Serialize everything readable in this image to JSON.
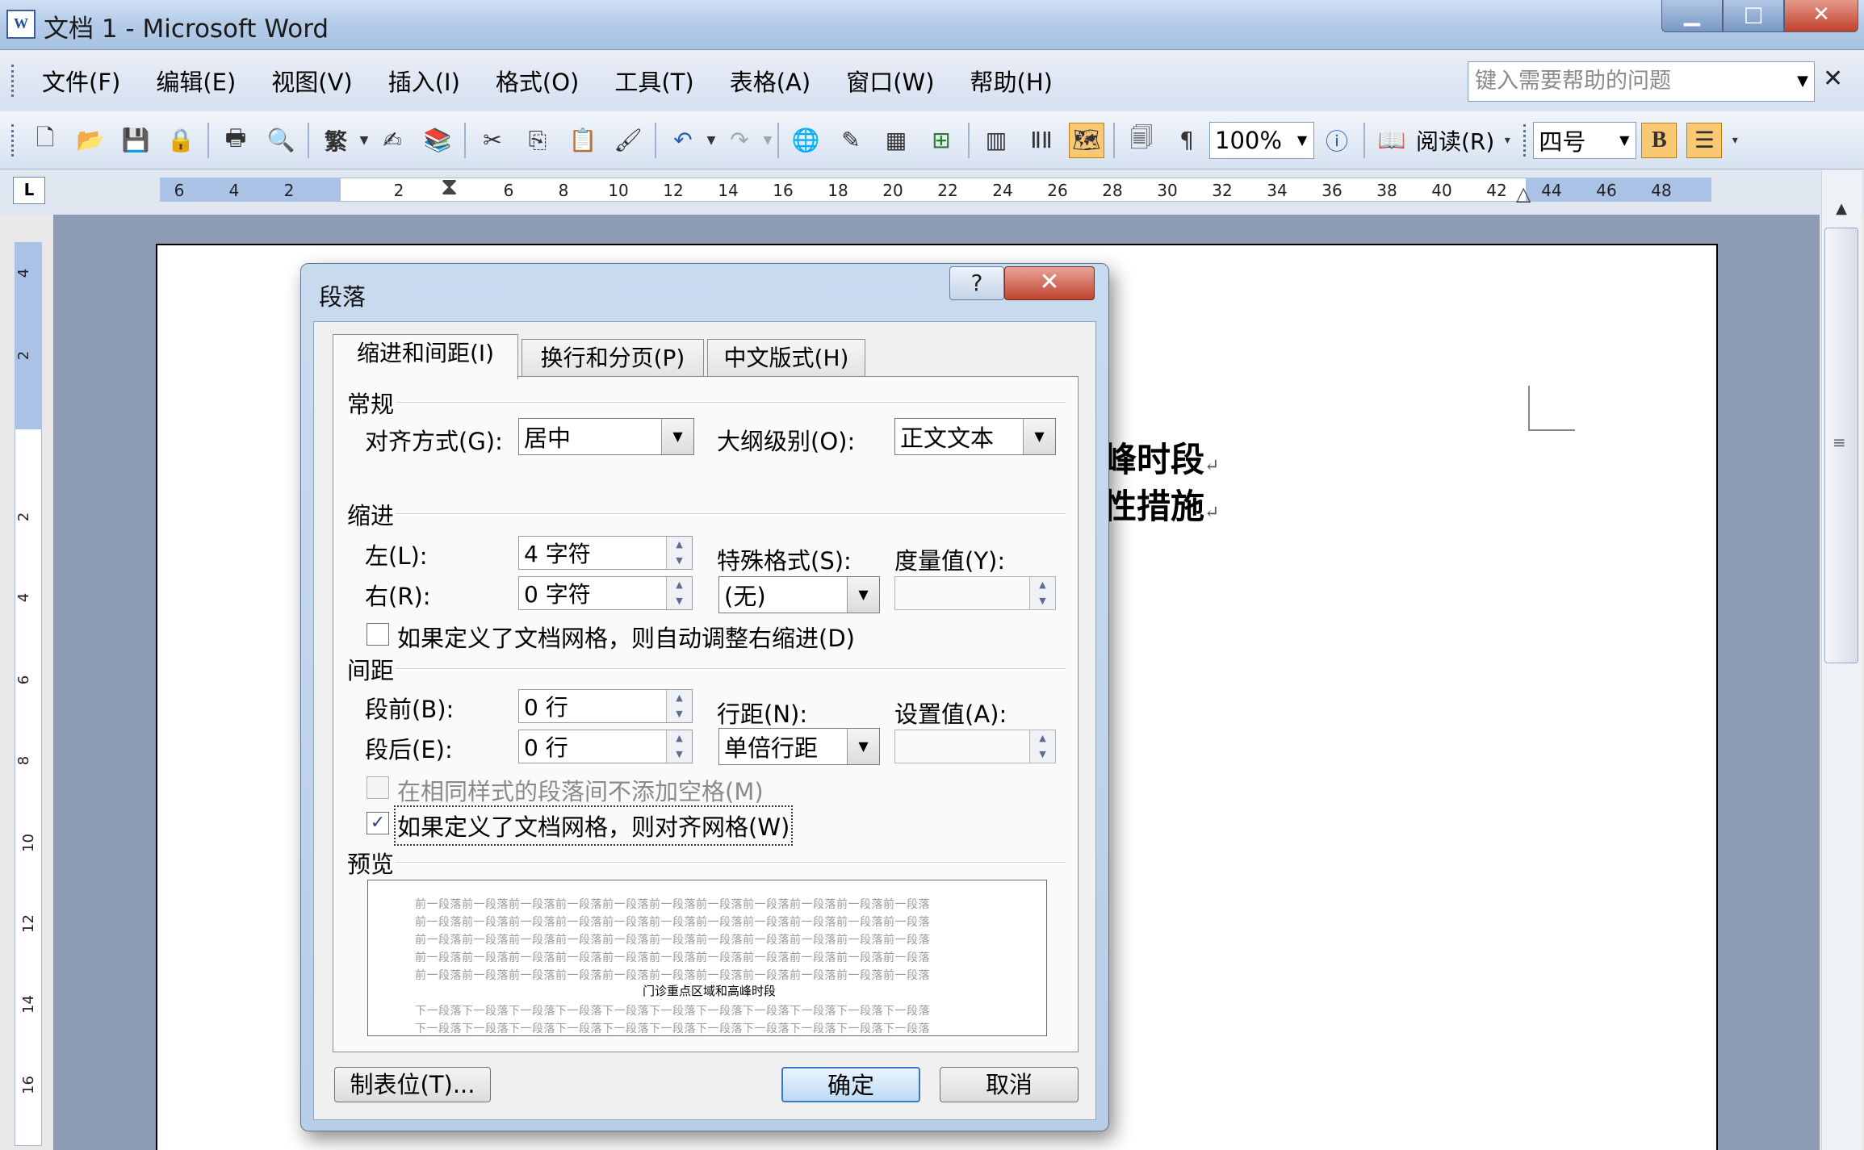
{
  "window": {
    "title": "文档 1 - Microsoft Word",
    "icon_glyph": "W",
    "min_glyph": "▁",
    "max_glyph": "□",
    "close_glyph": "✕"
  },
  "menu": {
    "items": [
      "文件(F)",
      "编辑(E)",
      "视图(V)",
      "插入(I)",
      "格式(O)",
      "工具(T)",
      "表格(A)",
      "窗口(W)",
      "帮助(H)"
    ],
    "help_placeholder": "键入需要帮助的问题",
    "close_glyph": "✕"
  },
  "toolbar": {
    "traditional_label": "繁",
    "zoom_value": "100%",
    "read_label": "阅读(R)",
    "font_size_value": "四号",
    "bold_label": "B"
  },
  "ruler": {
    "horizontal_ticks": [
      "6",
      "4",
      "2",
      "2",
      "6",
      "8",
      "10",
      "12",
      "14",
      "16",
      "18",
      "20",
      "22",
      "24",
      "26",
      "28",
      "30",
      "32",
      "34",
      "36",
      "38",
      "40",
      "42",
      "44",
      "46",
      "48"
    ],
    "vertical_ticks": [
      "4",
      "2",
      "2",
      "4",
      "6",
      "8",
      "10",
      "12",
      "14",
      "16"
    ],
    "corner_glyph": "L"
  },
  "document": {
    "line1": "峰时段",
    "line2": "性措施",
    "para_mark": "↵"
  },
  "dialog": {
    "title": "段落",
    "help_glyph": "?",
    "close_glyph": "✕",
    "tabs": [
      "缩进和间距(I)",
      "换行和分页(P)",
      "中文版式(H)"
    ],
    "general": {
      "title": "常规",
      "alignment_label": "对齐方式(G):",
      "alignment_value": "居中",
      "outline_label": "大纲级别(O):",
      "outline_value": "正文文本"
    },
    "indent": {
      "title": "缩进",
      "left_label": "左(L):",
      "left_value": "4 字符",
      "right_label": "右(R):",
      "right_value": "0 字符",
      "special_label": "特殊格式(S):",
      "special_value": "(无)",
      "measure_label": "度量值(Y):",
      "measure_value": "",
      "auto_adjust_label": "如果定义了文档网格，则自动调整右缩进(D)"
    },
    "spacing": {
      "title": "间距",
      "before_label": "段前(B):",
      "before_value": "0 行",
      "after_label": "段后(E):",
      "after_value": "0 行",
      "line_label": "行距(N):",
      "line_value": "单倍行距",
      "setting_label": "设置值(A):",
      "setting_value": "",
      "no_space_label": "在相同样式的段落间不添加空格(M)",
      "snap_grid_label": "如果定义了文档网格，则对齐网格(W)",
      "snap_grid_checked": "✓"
    },
    "preview": {
      "title": "预览",
      "prev_line": "前一段落前一段落前一段落前一段落前一段落前一段落前一段落前一段落前一段落前一段落前一段落",
      "main_line": "门诊重点区域和高峰时段",
      "next_line": "下一段落下一段落下一段落下一段落下一段落下一段落下一段落下一段落下一段落下一段落下一段落"
    },
    "buttons": {
      "tabs": "制表位(T)...",
      "ok": "确定",
      "cancel": "取消"
    }
  }
}
